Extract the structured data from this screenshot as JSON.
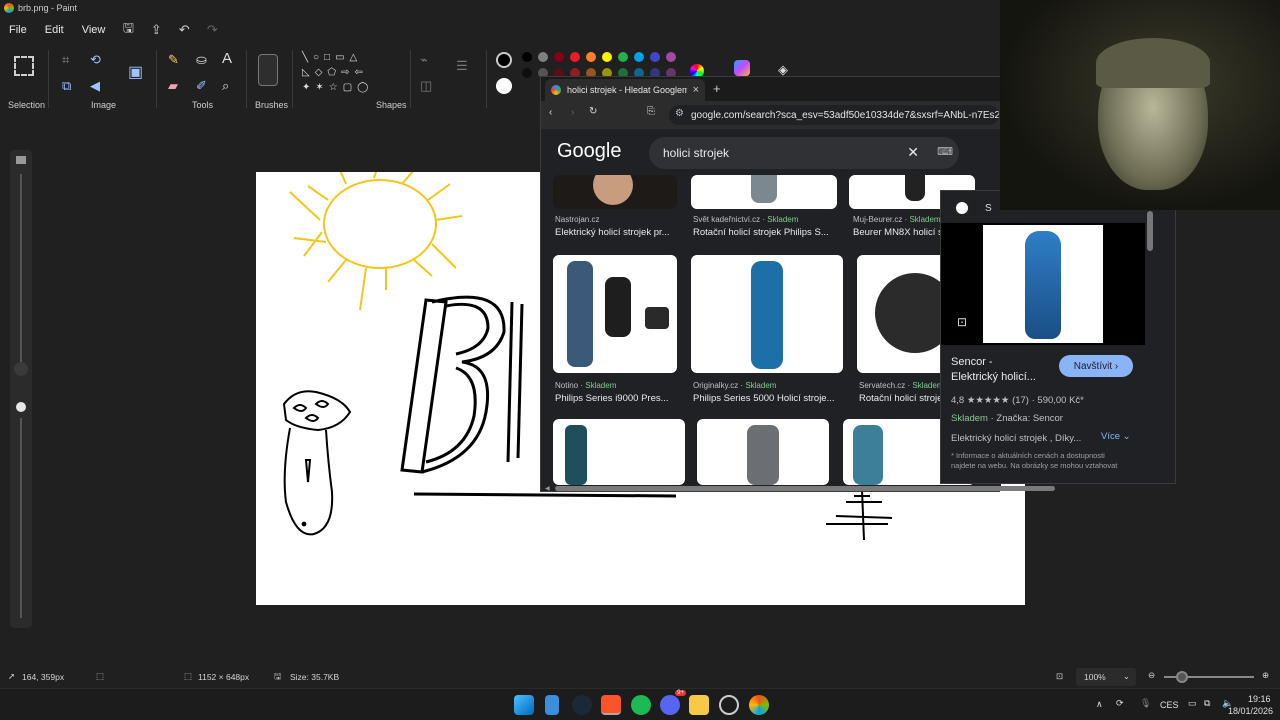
{
  "paint": {
    "title": "brb.png - Paint",
    "menu": [
      "File",
      "Edit",
      "View"
    ],
    "groups": {
      "selection": "Selection",
      "image": "Image",
      "tools": "Tools",
      "brushes": "Brushes",
      "shapes": "Shapes"
    },
    "status": {
      "cursor": "164, 359px",
      "dimensions": "1152 × 648px",
      "size": "Size: 35.7KB",
      "zoom": "100%"
    },
    "colors": [
      "#000000",
      "#7f7f7f",
      "#880015",
      "#ed1c24",
      "#ff7f27",
      "#fff200",
      "#22b14c",
      "#00a2e8",
      "#3f48cc",
      "#a349a4"
    ]
  },
  "browser": {
    "tab_title": "holici strojek - Hledat Googlem",
    "new_tab": "+",
    "close_tab": "×",
    "url": "google.com/search?sca_esv=53adf50e10334de7&sxsrf=ANbL-n7Es2luN...",
    "logo": "Google",
    "query": "holici strojek",
    "top_row": [
      {
        "site": "Nastrojan.cz",
        "stock": "",
        "title": "Elektrický holicí strojek pr..."
      },
      {
        "site": "Svět kadeřnictví.cz · ",
        "stock": "Skladem",
        "title": "Rotační holicí strojek Philips S..."
      },
      {
        "site": "Muj-Beurer.cz · ",
        "stock": "Skladem",
        "title": "Beurer MN8X holicí s..."
      }
    ],
    "mid_row": [
      {
        "site": "Notino · ",
        "stock": "Skladem",
        "title": "Philips Series i9000 Pres..."
      },
      {
        "site": "Originalky.cz · ",
        "stock": "Skladem",
        "title": "Philips Series 5000 Holicí stroje..."
      },
      {
        "site": "Servatech.cz · ",
        "stock": "Skladem",
        "title": "Rotační holicí strojek..."
      }
    ]
  },
  "panel": {
    "brand_initial": "S",
    "product_name_line1": "Sencor -",
    "product_name_line2": "Elektrický holicí...",
    "visit_button": "Navštívit ›",
    "rating": "4,8 ★★★★★ (17) · 590,00 Kč*",
    "stock": "Skladem",
    "brand": " · Značka: Sencor",
    "desc": "Elektrický holicí strojek , Díky...",
    "more": "Více ⌄",
    "disclaimer1": "* Informace o aktuálních cenách a dostupnosti",
    "disclaimer2": "najdete na webu. Na obrázky se mohou vztahovat"
  },
  "taskbar": {
    "lang": "CES",
    "time": "19:16",
    "date": "18/01/2026",
    "discord_badge": "9+"
  }
}
